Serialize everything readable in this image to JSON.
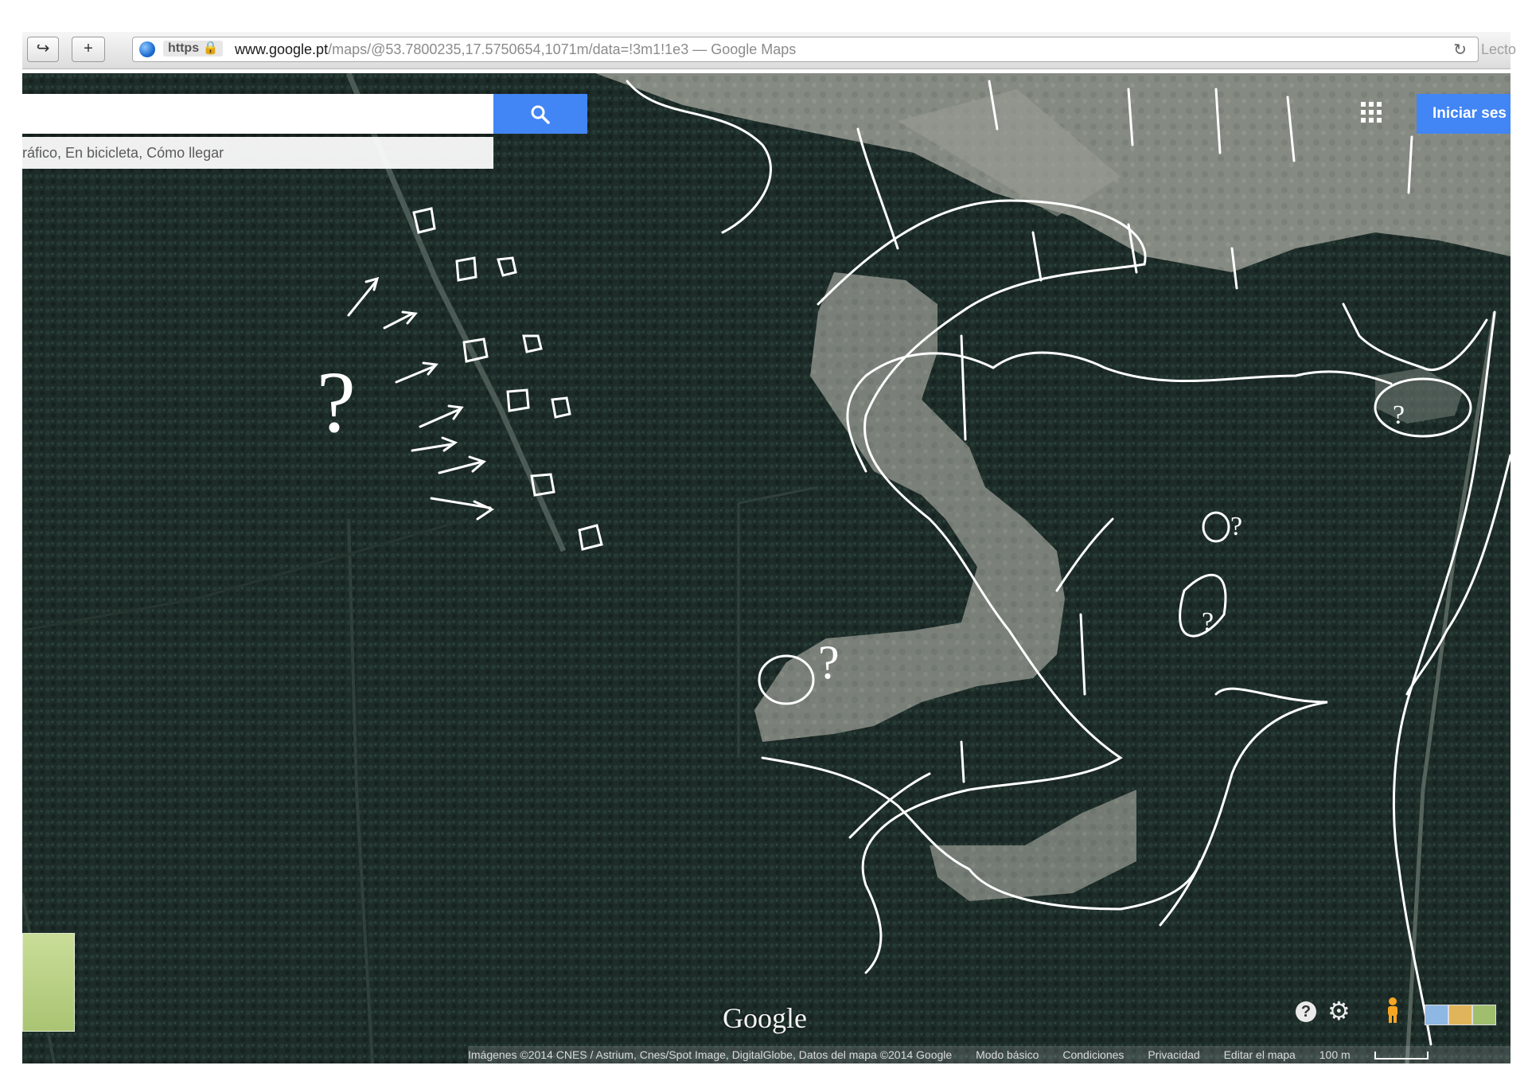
{
  "browser": {
    "protocol": "https",
    "url_host": "www.google.pt",
    "url_rest": "/maps/@53.7800235,17.5750654,1071m/data=!3m1!1e3",
    "page_title": "— Google Maps",
    "reader_label": "Lecto"
  },
  "map": {
    "search": {
      "value": "",
      "links": "ráfico, En bicicleta, Cómo llegar"
    },
    "signin_label": "Iniciar ses",
    "logo": "Google",
    "footer": {
      "imagery": "Imágenes ©2014 CNES / Astrium, Cnes/Spot Image, DigitalGlobe, Datos del mapa ©2014 Google",
      "basic_mode": "Modo básico",
      "terms": "Condiciones",
      "privacy": "Privacidad",
      "edit": "Editar el mapa",
      "scale": "100 m"
    },
    "annotations": {
      "question_mark": "?"
    },
    "colors": {
      "forest": "#1c2b27",
      "field": "#8c9088",
      "accent": "#4285f4"
    }
  }
}
